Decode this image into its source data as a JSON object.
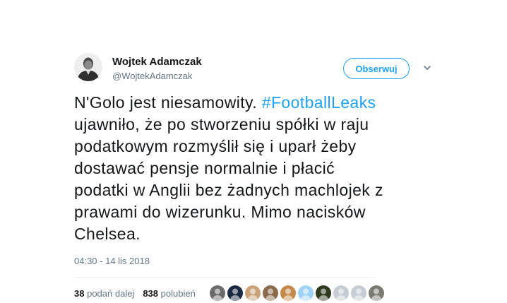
{
  "author": {
    "name": "Wojtek Adamczak",
    "handle": "@WojtekAdamczak",
    "avatar_icon": "portrait-avatar-icon"
  },
  "follow_button": {
    "label": "Obserwuj"
  },
  "tweet": {
    "text_before": "N'Golo jest niesamowity. ",
    "hashtag": "#FootballLeaks",
    "text_after": " ujawniło, że po stworzeniu spółki w raju podatkowym rozmyślił się i uparł żeby dostawać pensje normalnie i płacić podatki w Anglii bez żadnych machlojek z prawami do wizerunku. Mimo nacisków Chelsea.",
    "timestamp": "04:30 - 14 lis 2018"
  },
  "stats": {
    "retweets_count": "38",
    "retweets_label": "podań dalej",
    "likes_count": "838",
    "likes_label": "polubień"
  },
  "likers": [
    {
      "icon": "liker-avatar-icon",
      "color": "#6b6b6b"
    },
    {
      "icon": "liker-avatar-icon",
      "color": "#1b2a44"
    },
    {
      "icon": "liker-avatar-icon",
      "color": "#c9a27a"
    },
    {
      "icon": "liker-avatar-icon",
      "color": "#8a6a4a"
    },
    {
      "icon": "liker-avatar-icon",
      "color": "#c48a4a"
    },
    {
      "icon": "liker-avatar-icon",
      "color": "#9fd3f5"
    },
    {
      "icon": "liker-avatar-icon",
      "color": "#2e3a1e"
    },
    {
      "icon": "liker-avatar-icon",
      "color": "#c5ccd3"
    },
    {
      "icon": "liker-avatar-icon",
      "color": "#c5ccd3"
    },
    {
      "icon": "liker-avatar-icon",
      "color": "#7a7a72"
    }
  ],
  "colors": {
    "accent": "#1da1f2",
    "text": "#14171a",
    "muted": "#657786"
  }
}
